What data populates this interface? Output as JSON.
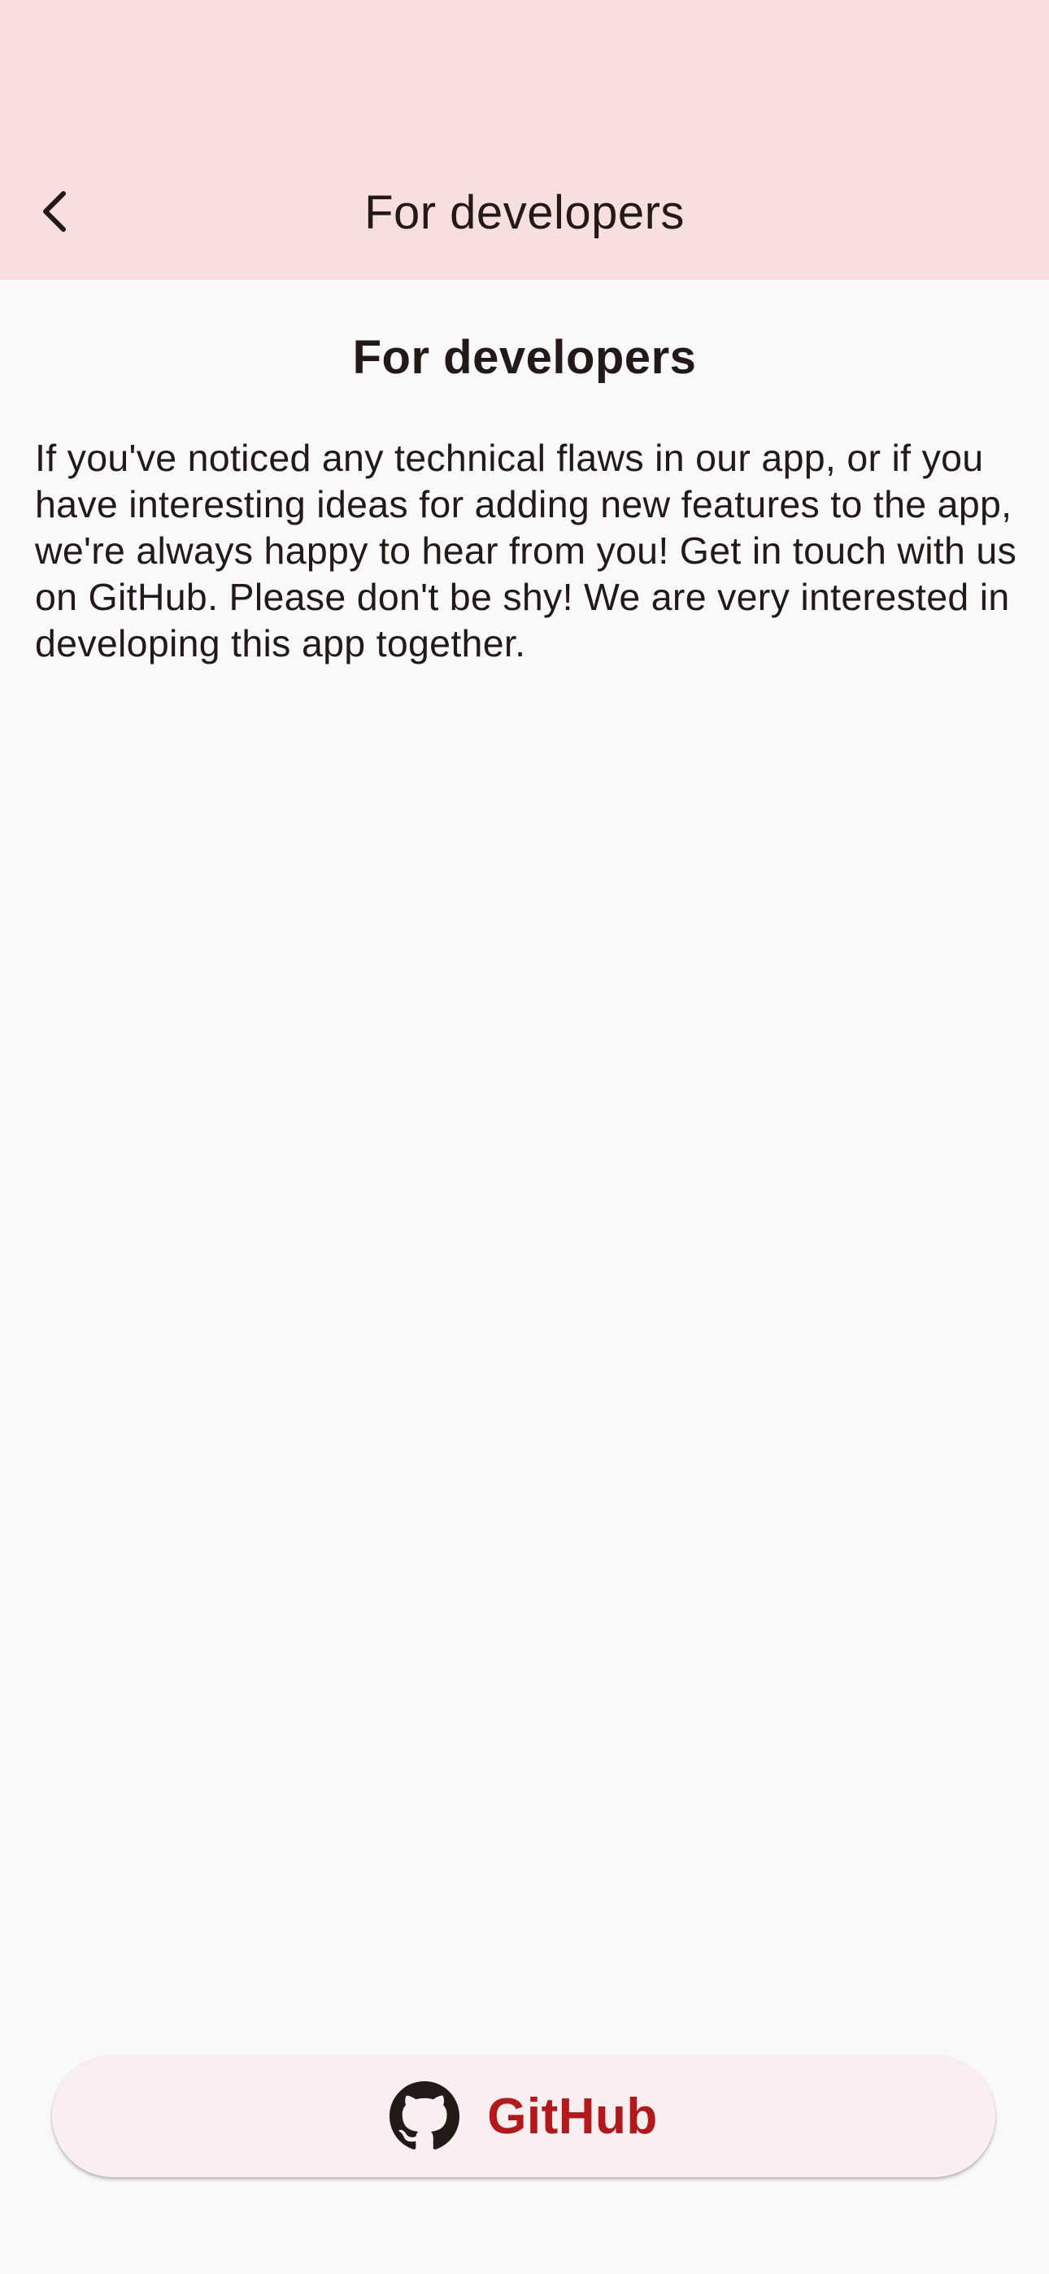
{
  "app_bar": {
    "title": "For developers",
    "back_icon": "chevron-left-icon"
  },
  "content": {
    "title": "For developers",
    "body": "If you've noticed any technical flaws in our app, or if you have interesting ideas for adding new features to the app, we're always happy to hear from you! Get in touch with us on GitHub. Please don't be shy! We are very interested in developing this app together."
  },
  "github_button": {
    "label": "GitHub",
    "icon": "github-icon"
  },
  "colors": {
    "app_bar_bg": "#f6dfdc",
    "page_bg": "#f9f9f9",
    "text": "#231919",
    "button_bg": "#fbeef1",
    "button_text": "#b3191b"
  }
}
